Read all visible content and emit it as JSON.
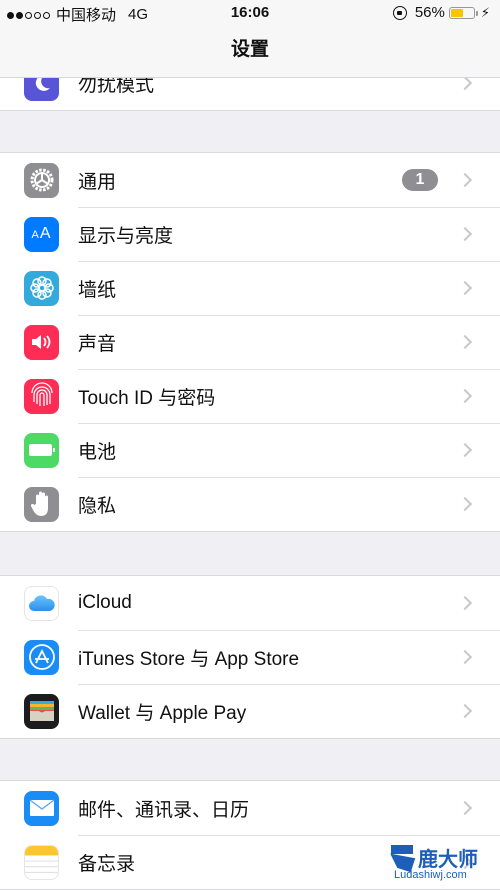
{
  "status_bar": {
    "signal_filled": 2,
    "signal_total": 5,
    "carrier": "中国移动",
    "network": "4G",
    "time": "16:06",
    "orientation_lock_icon": "orientation-lock-icon",
    "battery_percent_label": "56%",
    "battery_level": 0.56,
    "battery_color": "#f7c600",
    "charging_icon": "bolt-icon"
  },
  "nav": {
    "title": "设置"
  },
  "groups": [
    {
      "rows": [
        {
          "label": "勿扰模式",
          "icon": "moon-icon",
          "color": "#5856d6"
        }
      ]
    },
    {
      "rows": [
        {
          "label": "通用",
          "icon": "gear-icon",
          "color": "#8e8e93",
          "badge": "1"
        },
        {
          "label": "显示与亮度",
          "icon": "text-size-icon",
          "color": "#007aff",
          "icon_text": "AA"
        },
        {
          "label": "墙纸",
          "icon": "flower-icon",
          "color": "#34aadc"
        },
        {
          "label": "声音",
          "icon": "speaker-icon",
          "color": "#ff2d55"
        },
        {
          "label": "Touch ID 与密码",
          "icon": "fingerprint-icon",
          "color": "#ff2d55"
        },
        {
          "label": "电池",
          "icon": "battery-icon",
          "color": "#4cd964"
        },
        {
          "label": "隐私",
          "icon": "hand-icon",
          "color": "#8e8e93"
        }
      ]
    },
    {
      "rows": [
        {
          "label": "iCloud",
          "icon": "cloud-icon",
          "color": "#ffffff"
        },
        {
          "label": "iTunes Store 与 App Store",
          "icon": "app-store-icon",
          "color": "#1a8cf5"
        },
        {
          "label": "Wallet 与 Apple Pay",
          "icon": "wallet-icon",
          "color": "#1c1c1e"
        }
      ]
    },
    {
      "rows": [
        {
          "label": "邮件、通讯录、日历",
          "icon": "mail-icon",
          "color": "#1a8cf5"
        },
        {
          "label": "备忘录",
          "icon": "notes-icon",
          "color": "#ffffff"
        }
      ]
    }
  ],
  "watermark": {
    "title": "鹿大师",
    "subtitle": "Ludashiwj.com"
  }
}
